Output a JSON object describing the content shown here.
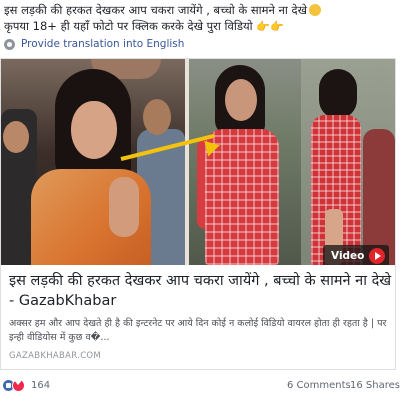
{
  "post": {
    "text_line1": "इस लड़की की हरकत देखकर आप चकरा जायेंगे , बच्चो के सामने ना देखे",
    "text_line2": "कृपया 18+ ही यहाँ फोटो पर क्लिक करके देखे पुरा विडियो",
    "hand_emoji": "👉👉"
  },
  "translate": {
    "label": "Provide translation into English"
  },
  "link": {
    "title": "इस लड़की की हरकत देखकर आप चकरा जायेंगे , बच्चो के सामने ना देखे - GazabKhabar",
    "description": "अक्सर हम और आप देखते ही है की इन्टरनेट पर आये दिन कोई न कलोई विडियो वायरल होता ही रहता है | पर इन्ही वीडियोस में कुछ व�...",
    "domain": "GAZABKHABAR.COM",
    "video_badge": "Video"
  },
  "footer": {
    "reactions_count": "164",
    "comments": "6 Comments",
    "shares": "16 Shares"
  },
  "colors": {
    "link_blue": "#365899",
    "video_red": "#e0242a",
    "like_blue": "#4267b2",
    "love_red": "#f0284a"
  }
}
